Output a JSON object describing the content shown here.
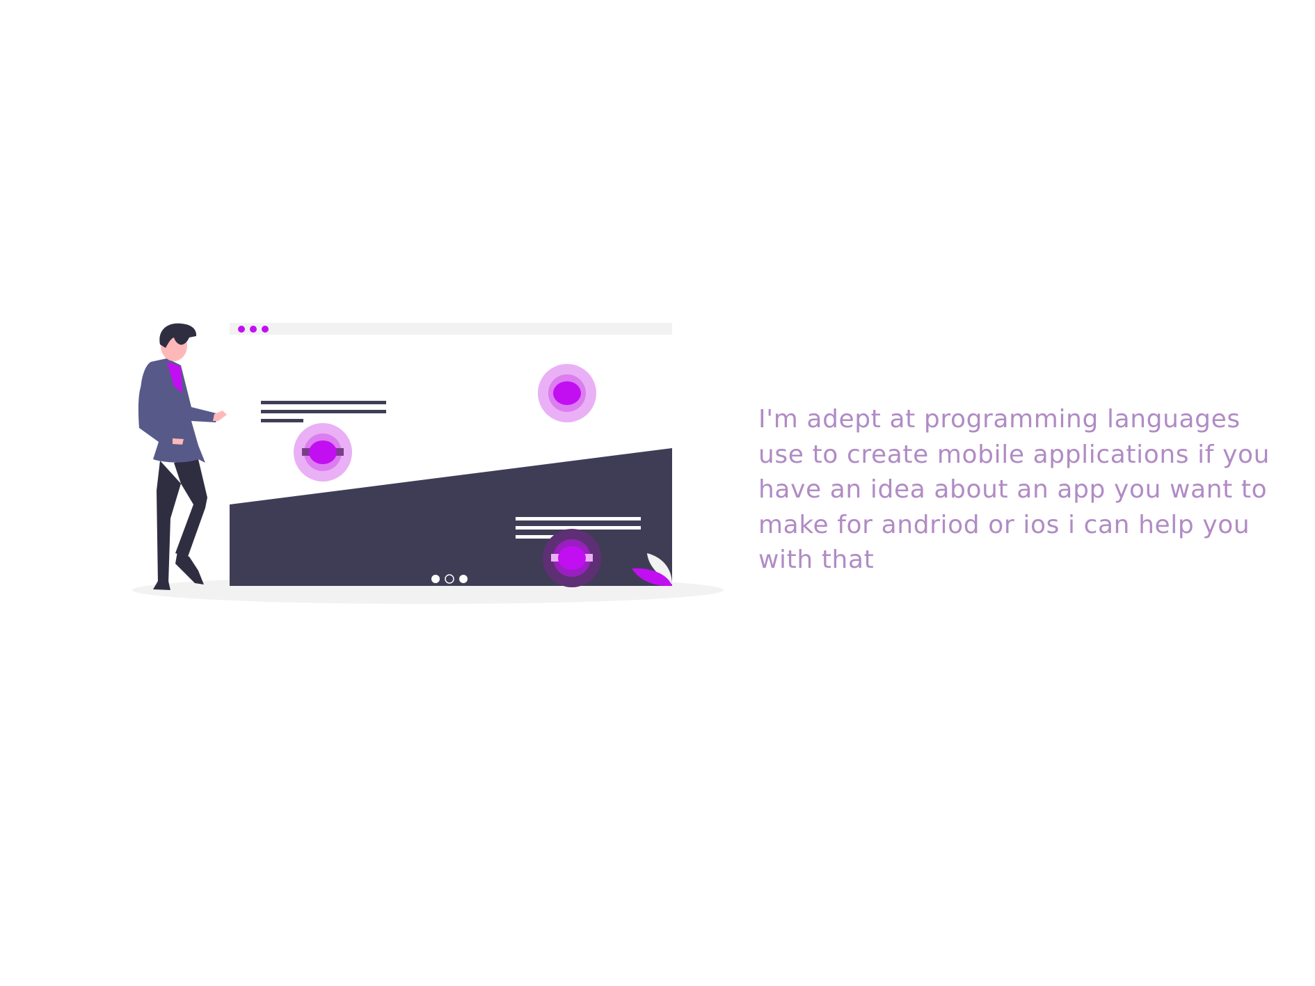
{
  "section": {
    "description": "I'm adept at programming languages use to create mobile applications if you have an idea about an app you want to make for andriod or ios i can help you with that"
  },
  "illustration": {
    "icon": "developer-presenting-web-page-illustration",
    "colors": {
      "accent": "#c20ff2",
      "accent_light": "#eab0f5",
      "dark": "#3f3d56",
      "suit": "#575a89",
      "pants": "#2f2e41",
      "skin": "#ffb8b8",
      "browser_bar": "#f2f2f2",
      "text": "#b08bc4"
    }
  }
}
